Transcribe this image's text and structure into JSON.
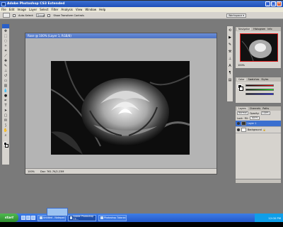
{
  "window": {
    "title": "Adobe Photoshop CS3 Extended",
    "buttons": {
      "minimize": "_",
      "maximize": "□",
      "close": "×"
    }
  },
  "menu": [
    "File",
    "Edit",
    "Image",
    "Layer",
    "Select",
    "Filter",
    "Analysis",
    "View",
    "Window",
    "Help"
  ],
  "options": {
    "auto_select_label": "Auto-Select:",
    "group_value": "Group",
    "show_transform_label": "Show Transform Controls",
    "workspace_label": "Workspace ▾"
  },
  "document": {
    "title": "Rose @ 100% (Layer 1, RGB/8)",
    "zoom": "100%",
    "doc_info": "Doc: 761.7K/2.23M"
  },
  "navigator": {
    "tabs": [
      "Navigator",
      "Histogram",
      "Info"
    ],
    "zoom": "100%"
  },
  "color_panel": {
    "tabs": [
      "Color",
      "Swatches",
      "Styles"
    ],
    "channels": [
      "R",
      "G",
      "B"
    ]
  },
  "layers": {
    "tabs": [
      "Layers",
      "Channels",
      "Paths"
    ],
    "blend_mode": "Normal",
    "opacity_label": "Opacity:",
    "opacity_value": "100%",
    "lock_label": "Lock:",
    "fill_label": "Fill:",
    "fill_value": "100%",
    "items": [
      {
        "name": "Layer 1"
      },
      {
        "name": "Background"
      }
    ]
  },
  "taskbar": {
    "start": "start",
    "tasks": [
      "Untitled - Notepad",
      "Adobe Photoshop CS...",
      "Photoshop Tutorial"
    ],
    "clock": "12:00 PM"
  },
  "icons": {
    "move_tool": "move-icon",
    "start": "windows-flag-icon"
  }
}
